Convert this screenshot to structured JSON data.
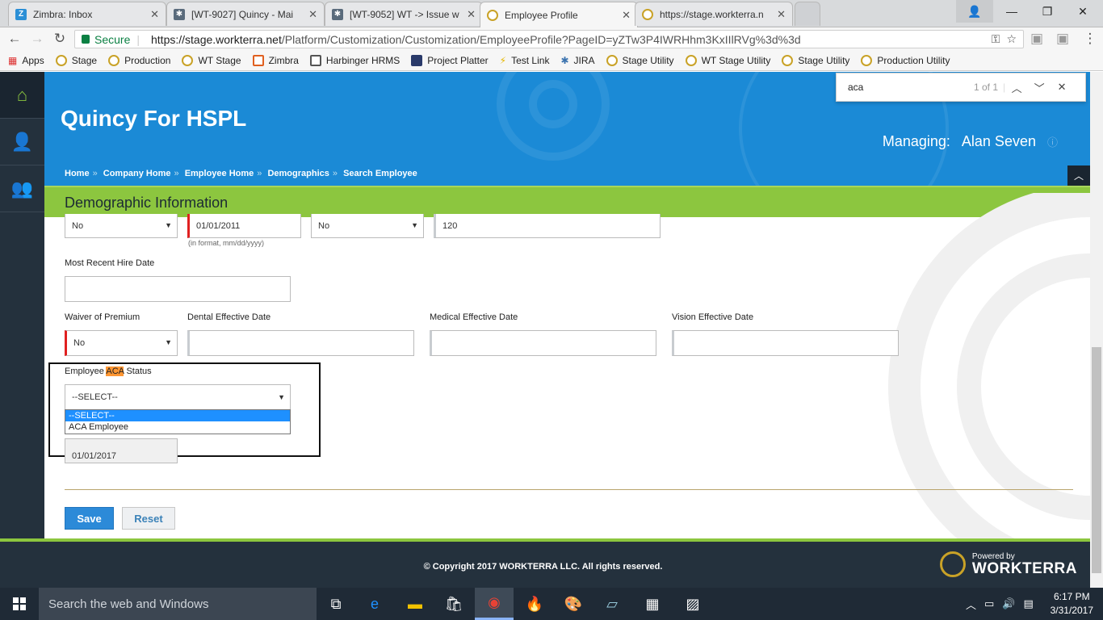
{
  "browser": {
    "tabs": [
      {
        "title": "Zimbra: Inbox",
        "icon": "zimbra-icon"
      },
      {
        "title": "[WT-9027] Quincy - Mai",
        "icon": "jira-icon"
      },
      {
        "title": "[WT-9052] WT -> Issue w",
        "icon": "jira-icon"
      },
      {
        "title": "Employee Profile",
        "icon": "worktera-icon"
      },
      {
        "title": "https://stage.workterra.n",
        "icon": "worktera-icon"
      }
    ],
    "secure_label": "Secure",
    "url_host": "https://stage.workterra.net",
    "url_path": "/Platform/Customization/Customization/EmployeeProfile?PageID=yZTw3P4IWRHhm3KxIIlRVg%3d%3d",
    "bookmarks": [
      "Apps",
      "Stage",
      "Production",
      "WT Stage",
      "Zimbra",
      "Harbinger HRMS",
      "Project Platter",
      "Test Link",
      "JIRA",
      "Stage Utility",
      "WT Stage Utility",
      "Stage Utility",
      "Production Utility"
    ]
  },
  "find": {
    "query": "aca",
    "count": "1 of 1"
  },
  "header": {
    "app_title": "Quincy For HSPL",
    "managing_label": "Managing:",
    "managing_name": "Alan Seven",
    "breadcrumbs": [
      "Home",
      "Company Home",
      "Employee Home",
      "Demographics",
      "Search Employee"
    ],
    "section_title": "Demographic Information"
  },
  "form": {
    "row1": {
      "select1": "No",
      "date1": "01/01/2011",
      "date_hint": "(in format, mm/dd/yyyy)",
      "select2": "No",
      "number1": "120"
    },
    "most_recent_hire_label": "Most Recent Hire Date",
    "most_recent_hire_value": "",
    "waiver_label": "Waiver of Premium",
    "waiver_value": "No",
    "dental_label": "Dental Effective Date",
    "medical_label": "Medical Effective Date",
    "vision_label": "Vision Effective Date",
    "aca_label_before": "Employee ",
    "aca_label_mark": "ACA",
    "aca_label_after": " Status",
    "aca_value": "--SELECT--",
    "aca_options": [
      "--SELECT--",
      "ACA Employee"
    ],
    "aca_date_value": "01/01/2017",
    "save_label": "Save",
    "reset_label": "Reset"
  },
  "footer": {
    "copyright": "© Copyright 2017 WORKTERRA LLC. All rights reserved.",
    "powered_by": "Powered by",
    "brand": "WORKTERRA"
  },
  "taskbar": {
    "search_placeholder": "Search the web and Windows",
    "time": "6:17 PM",
    "date": "3/31/2017"
  },
  "colors": {
    "banner": "#1b8ad6",
    "section_bar": "#8cc63f",
    "nav": "#24313d",
    "save": "#2c8ad8"
  }
}
